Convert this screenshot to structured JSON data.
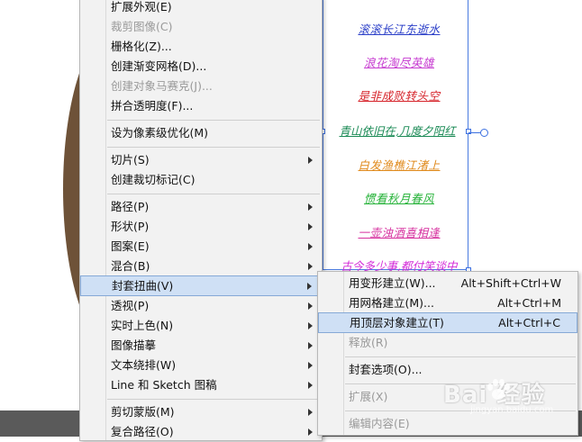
{
  "canvas": {
    "poem_lines": [
      {
        "text": "滚滚长江东逝水",
        "color": "#2b3fc8"
      },
      {
        "text": "浪花淘尽英雄",
        "color": "#c63ad0"
      },
      {
        "text": "是非成败转头空",
        "color": "#d6232a"
      },
      {
        "text": "青山依旧在,几度夕阳红",
        "color": "#1a8a55"
      },
      {
        "text": "白发渔樵江渚上",
        "color": "#e08a1c"
      },
      {
        "text": "惯看秋月春风",
        "color": "#27b33a"
      },
      {
        "text": "一壶浊酒喜相逢",
        "color": "#d62f9e"
      },
      {
        "text": "古今多少事,都付笑谈中",
        "color": "#d42ad8"
      }
    ]
  },
  "context_menu": {
    "items": [
      {
        "label": "扩展外观(E)",
        "disabled": false,
        "submenu": false
      },
      {
        "label": "裁剪图像(C)",
        "disabled": true,
        "submenu": false
      },
      {
        "label": "栅格化(Z)...",
        "disabled": false,
        "submenu": false
      },
      {
        "label": "创建渐变网格(D)...",
        "disabled": false,
        "submenu": false
      },
      {
        "label": "创建对象马赛克(J)...",
        "disabled": true,
        "submenu": false
      },
      {
        "label": "拼合透明度(F)...",
        "disabled": false,
        "submenu": false
      },
      {
        "label": "设为像素级优化(M)",
        "disabled": false,
        "submenu": false
      },
      {
        "label": "切片(S)",
        "disabled": false,
        "submenu": true
      },
      {
        "label": "创建裁切标记(C)",
        "disabled": false,
        "submenu": false
      },
      {
        "label": "路径(P)",
        "disabled": false,
        "submenu": true
      },
      {
        "label": "形状(P)",
        "disabled": false,
        "submenu": true
      },
      {
        "label": "图案(E)",
        "disabled": false,
        "submenu": true
      },
      {
        "label": "混合(B)",
        "disabled": false,
        "submenu": true
      },
      {
        "label": "封套扭曲(V)",
        "disabled": false,
        "submenu": true,
        "highlighted": true
      },
      {
        "label": "透视(P)",
        "disabled": false,
        "submenu": true
      },
      {
        "label": "实时上色(N)",
        "disabled": false,
        "submenu": true
      },
      {
        "label": "图像描摹",
        "disabled": false,
        "submenu": true
      },
      {
        "label": "文本绕排(W)",
        "disabled": false,
        "submenu": true
      },
      {
        "label": "Line 和 Sketch 图稿",
        "disabled": false,
        "submenu": true
      },
      {
        "label": "剪切蒙版(M)",
        "disabled": false,
        "submenu": true
      },
      {
        "label": "复合路径(O)",
        "disabled": false,
        "submenu": true
      }
    ]
  },
  "submenu": {
    "items": [
      {
        "label": "用变形建立(W)...",
        "shortcut": "Alt+Shift+Ctrl+W",
        "disabled": false
      },
      {
        "label": "用网格建立(M)...",
        "shortcut": "Alt+Ctrl+M",
        "disabled": false
      },
      {
        "label": "用顶层对象建立(T)",
        "shortcut": "Alt+Ctrl+C",
        "disabled": false,
        "highlighted": true
      },
      {
        "label": "释放(R)",
        "shortcut": "",
        "disabled": true
      },
      {
        "label": "封套选项(O)...",
        "shortcut": "",
        "disabled": false
      },
      {
        "label": "扩展(X)",
        "shortcut": "",
        "disabled": true
      },
      {
        "label": "编辑内容(E)",
        "shortcut": "",
        "disabled": true
      }
    ]
  },
  "watermark": {
    "main": "Bai 经验",
    "sub": "jingyan.baidu.com"
  }
}
